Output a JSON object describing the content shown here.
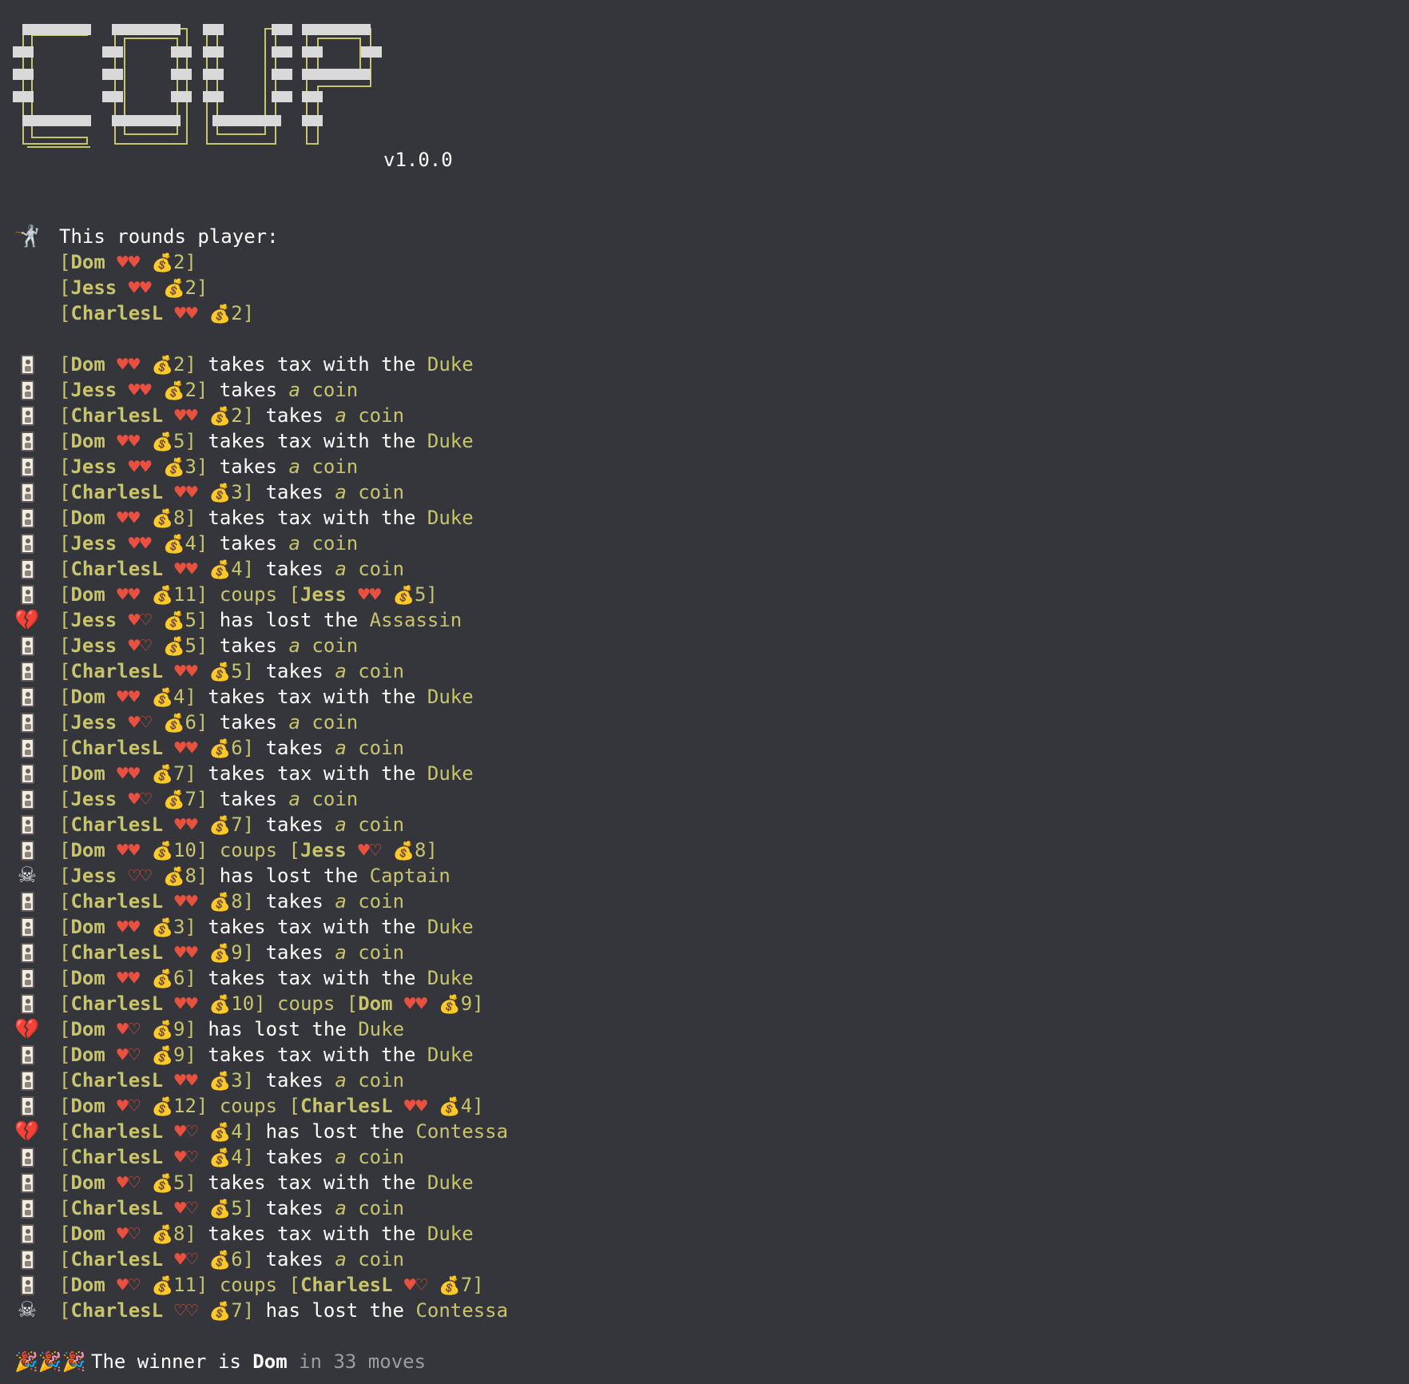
{
  "logo": {
    "text": "COUP",
    "version": "v1.0.0"
  },
  "header": {
    "icon": "fencer-icon",
    "title": "This rounds player:",
    "players": [
      {
        "name": "Dom",
        "lives": 2,
        "coins": 2
      },
      {
        "name": "Jess",
        "lives": 2,
        "coins": 2
      },
      {
        "name": "CharlesL",
        "lives": 2,
        "coins": 2
      }
    ]
  },
  "log": [
    {
      "icon": "card",
      "kind": "tax",
      "player": {
        "name": "Dom",
        "lives": 2,
        "coins": 2
      },
      "text": "takes tax with the",
      "target": "Duke"
    },
    {
      "icon": "card",
      "kind": "coin",
      "player": {
        "name": "Jess",
        "lives": 2,
        "coins": 2
      },
      "text": "takes",
      "target": "a coin"
    },
    {
      "icon": "card",
      "kind": "coin",
      "player": {
        "name": "CharlesL",
        "lives": 2,
        "coins": 2
      },
      "text": "takes",
      "target": "a coin"
    },
    {
      "icon": "card",
      "kind": "tax",
      "player": {
        "name": "Dom",
        "lives": 2,
        "coins": 5
      },
      "text": "takes tax with the",
      "target": "Duke"
    },
    {
      "icon": "card",
      "kind": "coin",
      "player": {
        "name": "Jess",
        "lives": 2,
        "coins": 3
      },
      "text": "takes",
      "target": "a coin"
    },
    {
      "icon": "card",
      "kind": "coin",
      "player": {
        "name": "CharlesL",
        "lives": 2,
        "coins": 3
      },
      "text": "takes",
      "target": "a coin"
    },
    {
      "icon": "card",
      "kind": "tax",
      "player": {
        "name": "Dom",
        "lives": 2,
        "coins": 8
      },
      "text": "takes tax with the",
      "target": "Duke"
    },
    {
      "icon": "card",
      "kind": "coin",
      "player": {
        "name": "Jess",
        "lives": 2,
        "coins": 4
      },
      "text": "takes",
      "target": "a coin"
    },
    {
      "icon": "card",
      "kind": "coin",
      "player": {
        "name": "CharlesL",
        "lives": 2,
        "coins": 4
      },
      "text": "takes",
      "target": "a coin"
    },
    {
      "icon": "card",
      "kind": "coup",
      "player": {
        "name": "Dom",
        "lives": 2,
        "coins": 11
      },
      "text": "coups",
      "victim": {
        "name": "Jess",
        "lives": 2,
        "coins": 5
      }
    },
    {
      "icon": "broken",
      "kind": "lost",
      "player": {
        "name": "Jess",
        "lives": 1,
        "coins": 5
      },
      "text": "has lost the",
      "target": "Assassin"
    },
    {
      "icon": "card",
      "kind": "coin",
      "player": {
        "name": "Jess",
        "lives": 1,
        "coins": 5
      },
      "text": "takes",
      "target": "a coin"
    },
    {
      "icon": "card",
      "kind": "coin",
      "player": {
        "name": "CharlesL",
        "lives": 2,
        "coins": 5
      },
      "text": "takes",
      "target": "a coin"
    },
    {
      "icon": "card",
      "kind": "tax",
      "player": {
        "name": "Dom",
        "lives": 2,
        "coins": 4
      },
      "text": "takes tax with the",
      "target": "Duke"
    },
    {
      "icon": "card",
      "kind": "coin",
      "player": {
        "name": "Jess",
        "lives": 1,
        "coins": 6
      },
      "text": "takes",
      "target": "a coin"
    },
    {
      "icon": "card",
      "kind": "coin",
      "player": {
        "name": "CharlesL",
        "lives": 2,
        "coins": 6
      },
      "text": "takes",
      "target": "a coin"
    },
    {
      "icon": "card",
      "kind": "tax",
      "player": {
        "name": "Dom",
        "lives": 2,
        "coins": 7
      },
      "text": "takes tax with the",
      "target": "Duke"
    },
    {
      "icon": "card",
      "kind": "coin",
      "player": {
        "name": "Jess",
        "lives": 1,
        "coins": 7
      },
      "text": "takes",
      "target": "a coin"
    },
    {
      "icon": "card",
      "kind": "coin",
      "player": {
        "name": "CharlesL",
        "lives": 2,
        "coins": 7
      },
      "text": "takes",
      "target": "a coin"
    },
    {
      "icon": "card",
      "kind": "coup",
      "player": {
        "name": "Dom",
        "lives": 2,
        "coins": 10
      },
      "text": "coups",
      "victim": {
        "name": "Jess",
        "lives": 1,
        "coins": 8
      }
    },
    {
      "icon": "skull",
      "kind": "lost",
      "player": {
        "name": "Jess",
        "lives": 0,
        "coins": 8
      },
      "text": "has lost the",
      "target": "Captain"
    },
    {
      "icon": "card",
      "kind": "coin",
      "player": {
        "name": "CharlesL",
        "lives": 2,
        "coins": 8
      },
      "text": "takes",
      "target": "a coin"
    },
    {
      "icon": "card",
      "kind": "tax",
      "player": {
        "name": "Dom",
        "lives": 2,
        "coins": 3
      },
      "text": "takes tax with the",
      "target": "Duke"
    },
    {
      "icon": "card",
      "kind": "coin",
      "player": {
        "name": "CharlesL",
        "lives": 2,
        "coins": 9
      },
      "text": "takes",
      "target": "a coin"
    },
    {
      "icon": "card",
      "kind": "tax",
      "player": {
        "name": "Dom",
        "lives": 2,
        "coins": 6
      },
      "text": "takes tax with the",
      "target": "Duke"
    },
    {
      "icon": "card",
      "kind": "coup",
      "player": {
        "name": "CharlesL",
        "lives": 2,
        "coins": 10
      },
      "text": "coups",
      "victim": {
        "name": "Dom",
        "lives": 2,
        "coins": 9
      }
    },
    {
      "icon": "broken",
      "kind": "lost",
      "player": {
        "name": "Dom",
        "lives": 1,
        "coins": 9
      },
      "text": "has lost the",
      "target": "Duke"
    },
    {
      "icon": "card",
      "kind": "tax",
      "player": {
        "name": "Dom",
        "lives": 1,
        "coins": 9
      },
      "text": "takes tax with the",
      "target": "Duke"
    },
    {
      "icon": "card",
      "kind": "coin",
      "player": {
        "name": "CharlesL",
        "lives": 2,
        "coins": 3
      },
      "text": "takes",
      "target": "a coin"
    },
    {
      "icon": "card",
      "kind": "coup",
      "player": {
        "name": "Dom",
        "lives": 1,
        "coins": 12
      },
      "text": "coups",
      "victim": {
        "name": "CharlesL",
        "lives": 2,
        "coins": 4
      }
    },
    {
      "icon": "broken",
      "kind": "lost",
      "player": {
        "name": "CharlesL",
        "lives": 1,
        "coins": 4
      },
      "text": "has lost the",
      "target": "Contessa"
    },
    {
      "icon": "card",
      "kind": "coin",
      "player": {
        "name": "CharlesL",
        "lives": 1,
        "coins": 4
      },
      "text": "takes",
      "target": "a coin"
    },
    {
      "icon": "card",
      "kind": "tax",
      "player": {
        "name": "Dom",
        "lives": 1,
        "coins": 5
      },
      "text": "takes tax with the",
      "target": "Duke"
    },
    {
      "icon": "card",
      "kind": "coin",
      "player": {
        "name": "CharlesL",
        "lives": 1,
        "coins": 5
      },
      "text": "takes",
      "target": "a coin"
    },
    {
      "icon": "card",
      "kind": "tax",
      "player": {
        "name": "Dom",
        "lives": 1,
        "coins": 8
      },
      "text": "takes tax with the",
      "target": "Duke"
    },
    {
      "icon": "card",
      "kind": "coin",
      "player": {
        "name": "CharlesL",
        "lives": 1,
        "coins": 6
      },
      "text": "takes",
      "target": "a coin"
    },
    {
      "icon": "card",
      "kind": "coup",
      "player": {
        "name": "Dom",
        "lives": 1,
        "coins": 11
      },
      "text": "coups",
      "victim": {
        "name": "CharlesL",
        "lives": 1,
        "coins": 7
      }
    },
    {
      "icon": "skull",
      "kind": "lost",
      "player": {
        "name": "CharlesL",
        "lives": 0,
        "coins": 7
      },
      "text": "has lost the",
      "target": "Contessa"
    }
  ],
  "winner": {
    "icon": "party-popper-icon",
    "prefix": "The winner is",
    "name": "Dom",
    "suffix": "in 33 moves"
  },
  "colors": {
    "background": "#35363b",
    "accent": "#c8c46c",
    "heart": "#e8513f",
    "text": "#ffffff",
    "muted": "#9d9d9d"
  }
}
